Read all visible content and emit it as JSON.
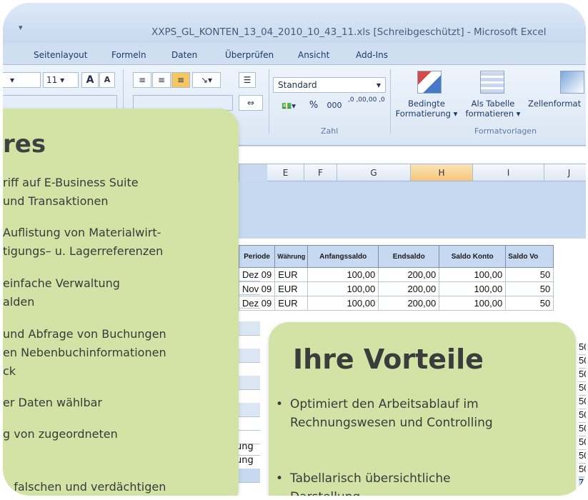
{
  "window": {
    "title": "XXPS_GL_KONTEN_13_04_2010_10_43_11.xls  [Schreibgeschützt]  -  Microsoft Excel",
    "qa_arrow": "₹"
  },
  "ribbon_tabs": [
    "Seitenlayout",
    "Formeln",
    "Daten",
    "Überprüfen",
    "Ansicht",
    "Add-Ins"
  ],
  "ribbon": {
    "font_size": "11",
    "font_grow": "A",
    "font_shrink": "A",
    "number_format": "Standard",
    "percent": "%",
    "thousands": "000",
    "dec_increase": ",0 ,00",
    "dec_decrease": ",00 ,0",
    "group_number": "Zahl",
    "group_styles": "Formatvorlagen",
    "cond_format_line1": "Bedingte",
    "cond_format_line2": "Formatierung",
    "as_table_line1": "Als Tabelle",
    "as_table_line2": "formatieren",
    "cell_styles": "Zellenformat"
  },
  "columns": [
    "E",
    "F",
    "G",
    "H",
    "I",
    "J"
  ],
  "table": {
    "headers": [
      "Periode",
      "Währung",
      "Anfangssaldo",
      "Endsaldo",
      "Saldo Konto",
      "Saldo Vo"
    ],
    "rows": [
      [
        "Dez 09",
        "EUR",
        "100,00",
        "200,00",
        "100,00",
        "50"
      ],
      [
        "Nov 09",
        "EUR",
        "100,00",
        "200,00",
        "100,00",
        "50"
      ],
      [
        "Dez 09",
        "EUR",
        "100,00",
        "200,00",
        "100,00",
        "50"
      ]
    ],
    "partial_right_values": [
      "50",
      "50",
      "50",
      "50",
      "50",
      "50",
      "50",
      "50",
      "50",
      "50",
      "7"
    ],
    "left_fragments": [
      "ung",
      "ung"
    ]
  },
  "features_card": {
    "heading": "res",
    "lines": [
      "riff auf E-Business Suite",
      "und Transaktionen",
      "Auflistung von  Materialwirt-",
      "tigungs– u. Lagerreferenzen",
      " einfache Verwaltung",
      "alden",
      "und Abfrage von Buchungen",
      "en Nebenbuchinformationen",
      "ck",
      "er Daten wählbar",
      "g von zugeordneten",
      "n falschen und verdächtigen"
    ]
  },
  "benefits_card": {
    "heading": "Ihre Vorteile",
    "bullets": [
      "Optimiert den Arbeitsablauf im Rechnungswesen und Controlling",
      "Tabellarisch übersichtliche Darstellung"
    ]
  }
}
